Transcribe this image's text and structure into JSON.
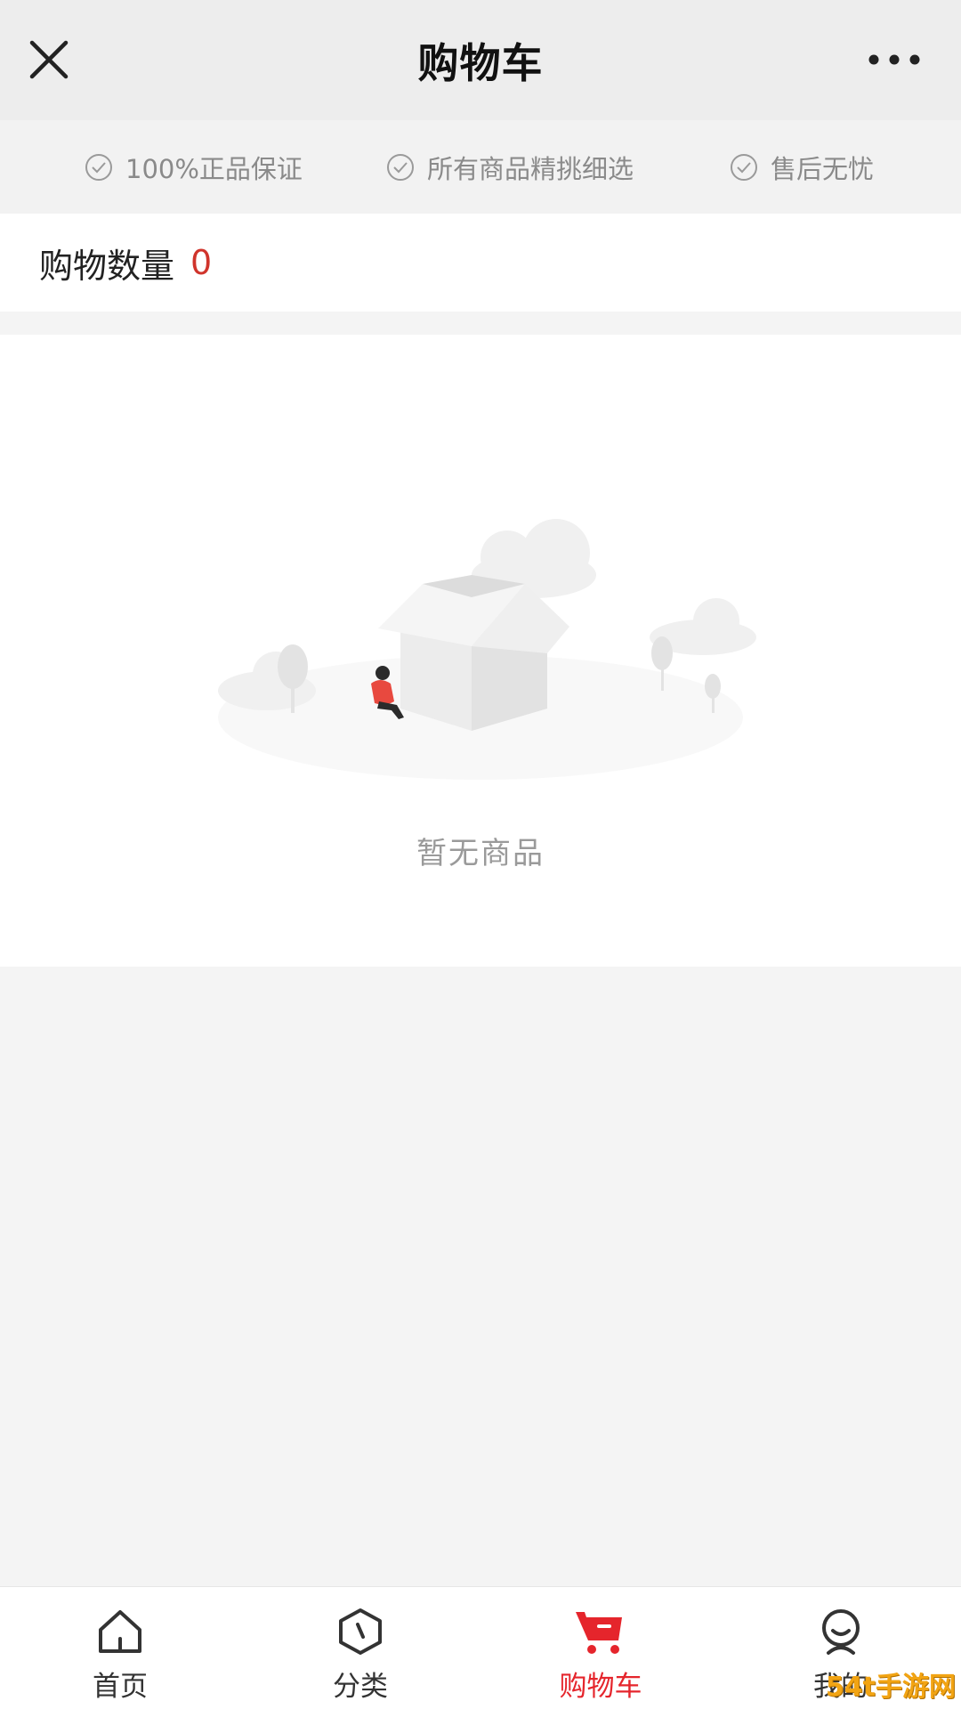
{
  "header": {
    "title": "购物车"
  },
  "guarantees": [
    {
      "label": "100%正品保证"
    },
    {
      "label": "所有商品精挑细选"
    },
    {
      "label": "售后无忧"
    }
  ],
  "cart": {
    "count_label": "购物数量",
    "count": "0"
  },
  "empty": {
    "message": "暂无商品"
  },
  "tabbar": {
    "items": [
      {
        "label": "首页",
        "icon": "home-icon"
      },
      {
        "label": "分类",
        "icon": "category-icon"
      },
      {
        "label": "购物车",
        "icon": "cart-icon",
        "active": true
      },
      {
        "label": "我的",
        "icon": "profile-icon"
      }
    ]
  },
  "colors": {
    "accent": "#e5252c",
    "count": "#d0342c"
  },
  "watermark": "54t手游网"
}
